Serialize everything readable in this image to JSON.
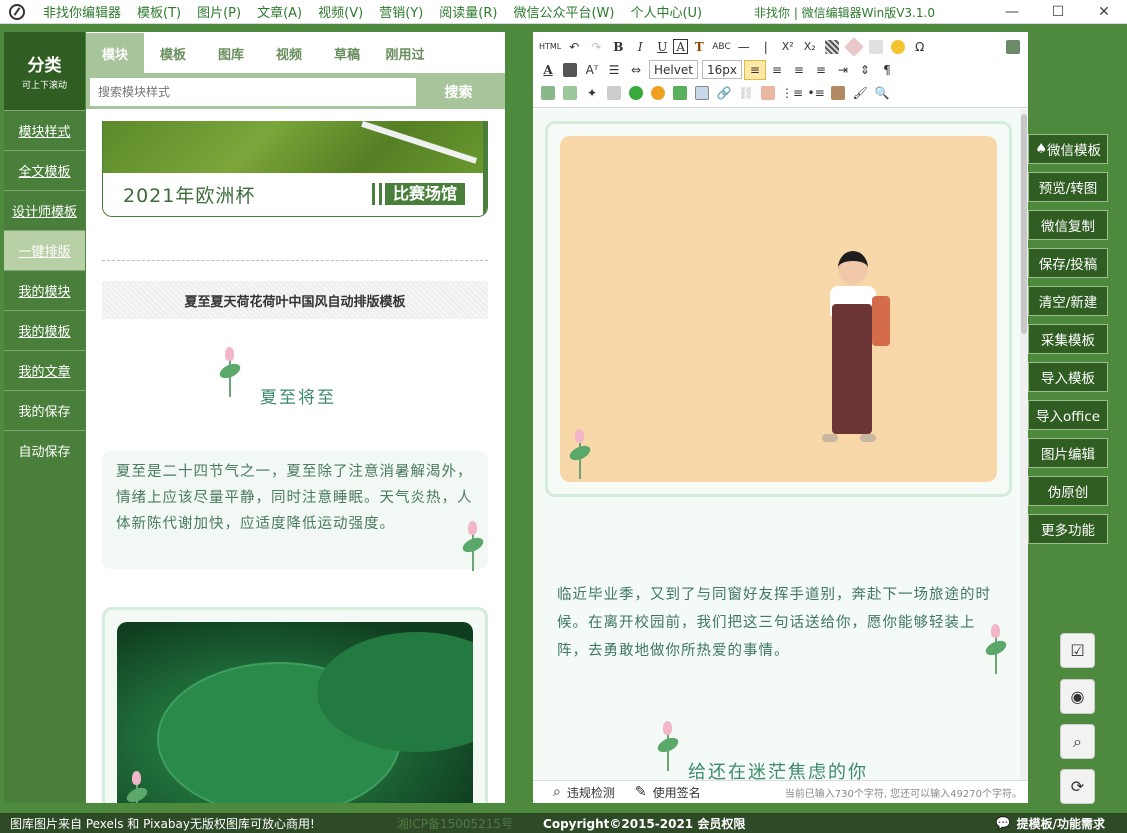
{
  "menu": [
    "非找你编辑器",
    "模板(T)",
    "图片(P)",
    "文章(A)",
    "视频(V)",
    "营销(Y)",
    "阅读量(R)",
    "微信公众平台(W)",
    "个人中心(U)"
  ],
  "window_title": "非找你 | 微信编辑器Win版V3.1.0",
  "win_controls": {
    "minimize": "—",
    "maximize": "☐",
    "close": "✕"
  },
  "sidebar": {
    "title": "分类",
    "subtitle": "可上下滚动",
    "items": [
      "模块样式",
      "全文模板",
      "设计师模板",
      "一键排版",
      "我的模块",
      "我的模板",
      "我的文章",
      "我的保存",
      "自动保存"
    ],
    "active_index": 3
  },
  "library": {
    "tabs": [
      "模块",
      "模板",
      "图库",
      "视频",
      "草稿",
      "刚用过"
    ],
    "active_tab": 0,
    "search_placeholder": "搜索模块样式",
    "search_button": "搜索",
    "euro_title": "2021年欧洲杯",
    "euro_tag": "比赛场馆",
    "template_name": "夏至夏天荷花荷叶中国风自动排版模板",
    "summer_title": "夏至将至",
    "summer_text": "夏至是二十四节气之一，夏至除了注意消暑解渴外，情绪上应该尽量平静，同时注意睡眠。天气炎热，人体新陈代谢加快，应适度降低运动强度。"
  },
  "toolbar": {
    "html": "HTML",
    "undo": "↶",
    "redo": "↷",
    "bold": "B",
    "italic": "I",
    "underline": "U",
    "font_border": "A",
    "font_color_t": "T",
    "abc": "ABC",
    "hr": "—",
    "bar": "|",
    "superscript": "X²",
    "subscript": "X₂",
    "omega": "Ω",
    "font_family": "Helvet",
    "font_size": "16px"
  },
  "editor": {
    "grad_text": "临近毕业季，又到了与同窗好友挥手道别，奔赴下一场旅途的时候。在离开校园前，我们把这三句话送给你，愿你能够轻装上阵，去勇敢地做你所热爱的事情。",
    "anxiety_title": "给还在迷茫焦虑的你",
    "status": {
      "check": "违规检测",
      "signature": "使用签名",
      "count": "当前已输入730个字符, 您还可以输入49270个字符。"
    }
  },
  "actions": [
    "微信模板",
    "预览/转图",
    "微信复制",
    "保存/投稿",
    "清空/新建",
    "采集模板",
    "导入模板",
    "导入office",
    "图片编辑",
    "伪原创",
    "更多功能"
  ],
  "footer": {
    "left": "图库图片来自 Pexels 和 Pixabay无版权图库可放心商用!",
    "icp": "湘ICP备15005215号",
    "copyright": "Copyright©2015-2021 会员权限",
    "right": "提模板/功能需求"
  },
  "colors": {
    "brand": "#4a7f3b",
    "dark": "#2f5d22",
    "tab_bg": "#a8c49a",
    "text_green": "#3e8a6d"
  }
}
